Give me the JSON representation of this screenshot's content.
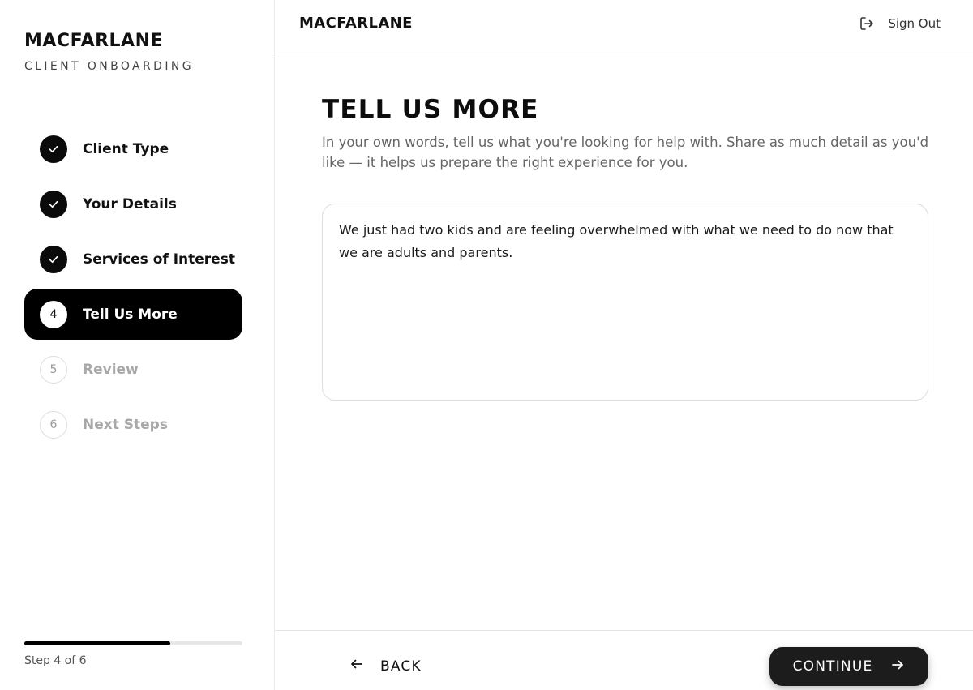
{
  "sidebar": {
    "brand_title": "MACFARLANE",
    "brand_subtitle": "CLIENT ONBOARDING",
    "steps": [
      {
        "number": "1",
        "label": "Client Type",
        "status": "done"
      },
      {
        "number": "2",
        "label": "Your Details",
        "status": "done"
      },
      {
        "number": "3",
        "label": "Services of Interest",
        "status": "done"
      },
      {
        "number": "4",
        "label": "Tell Us More",
        "status": "active"
      },
      {
        "number": "5",
        "label": "Review",
        "status": "todo"
      },
      {
        "number": "6",
        "label": "Next Steps",
        "status": "todo"
      }
    ],
    "progress_percent": 67,
    "step_count_text": "Step 4 of 6"
  },
  "header": {
    "logo": "MACFARLANE",
    "sign_out_label": "Sign Out",
    "sign_out_icon": "sign-out-icon"
  },
  "main": {
    "title": "TELL US MORE",
    "description": "In your own words, tell us what you're looking for help with. Share as much detail as you'd like — it helps us prepare the right experience for you.",
    "textarea_value": "We just had two kids and are feeling overwhelmed with what we need to do now that we are adults and parents."
  },
  "footer": {
    "back_label": "BACK",
    "back_icon": "arrow-left-icon",
    "continue_label": "CONTINUE",
    "continue_icon": "arrow-right-icon"
  },
  "colors": {
    "accent": "#000000",
    "muted_text": "#666666",
    "inactive_step": "#a8a8a8"
  }
}
